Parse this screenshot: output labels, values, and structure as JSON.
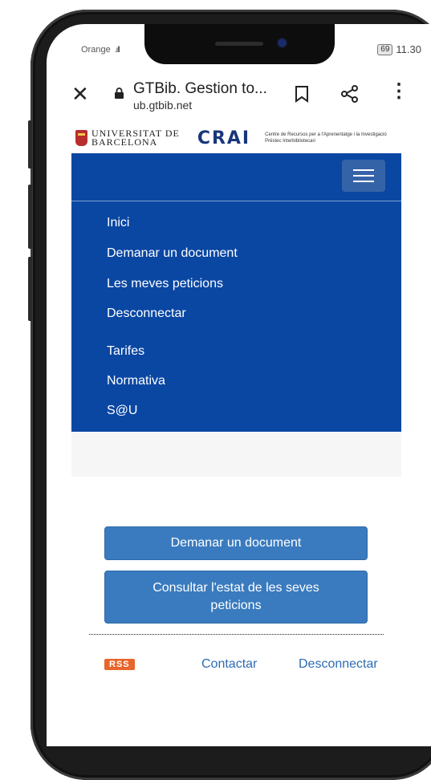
{
  "status_bar": {
    "carrier": "Orange",
    "signal": ".ıll",
    "battery": "69",
    "time": "11.30"
  },
  "browser": {
    "close_icon": "close-icon",
    "lock_icon": "lock-icon",
    "page_title": "GTBib. Gestion to...",
    "domain": "ub.gtbib.net",
    "bookmark_icon": "bookmark-icon",
    "share_icon": "share-icon",
    "more_icon": "more-vertical-icon"
  },
  "header": {
    "ub_line1": "UNIVERSITAT DE",
    "ub_line2": "BARCELONA",
    "crai": "CRAI",
    "crai_sub1": "Centre de Recursos per a l'Aprenentatge i la Investigació",
    "crai_sub2": "Préstec Interbibliotecari"
  },
  "nav": {
    "menu_icon": "hamburger-menu-icon",
    "items": [
      {
        "label": "Inici"
      },
      {
        "label": "Demanar un document"
      },
      {
        "label": "Les meves peticions"
      },
      {
        "label": "Desconnectar"
      },
      {
        "label": "Tarifes"
      },
      {
        "label": "Normativa"
      },
      {
        "label": "S@U"
      }
    ]
  },
  "actions": {
    "request_document": "Demanar un document",
    "check_status": "Consultar l'estat de les seves peticions"
  },
  "footer": {
    "rss": "RSS",
    "contact": "Contactar",
    "logout": "Desconnectar"
  },
  "colors": {
    "nav_background": "#0a47a3",
    "button_background": "#3a7bbf",
    "link_color": "#2d6cb5",
    "rss_badge": "#e8652b"
  }
}
